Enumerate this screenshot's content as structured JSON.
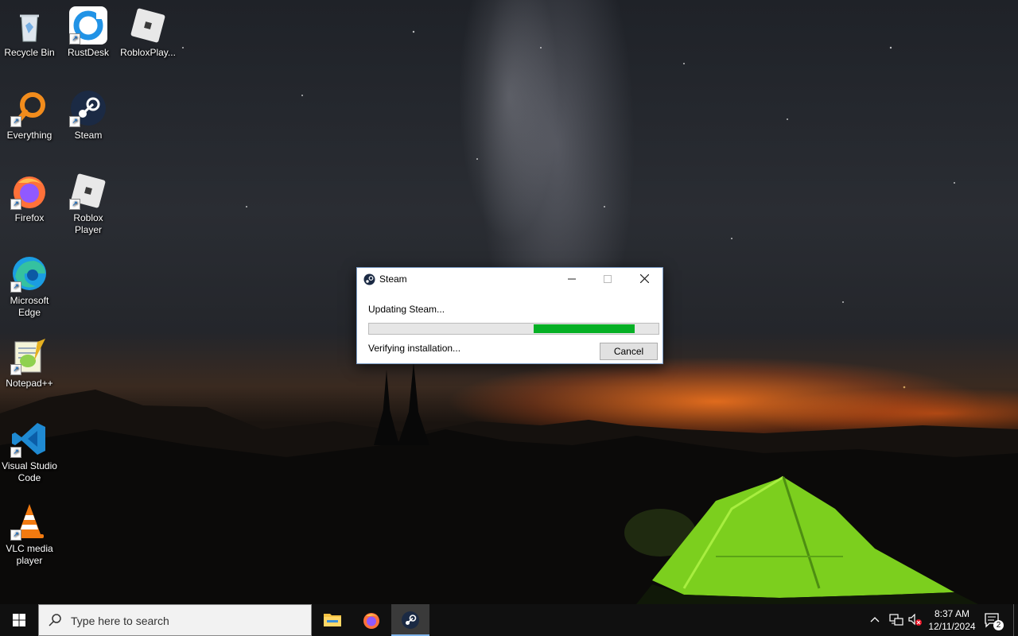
{
  "desktop_icons": [
    {
      "label": "Recycle Bin",
      "icon": "recycle-bin-icon"
    },
    {
      "label": "RustDesk",
      "icon": "rustdesk-icon"
    },
    {
      "label": "RobloxPlay...",
      "icon": "roblox-icon"
    },
    {
      "label": "Everything",
      "icon": "everything-search-icon"
    },
    {
      "label": "Steam",
      "icon": "steam-icon"
    },
    {
      "label": "Firefox",
      "icon": "firefox-icon"
    },
    {
      "label": "Roblox Player",
      "icon": "roblox-icon"
    },
    {
      "label": "Microsoft Edge",
      "icon": "edge-icon"
    },
    {
      "label": "Notepad++",
      "icon": "notepadpp-icon"
    },
    {
      "label": "Visual Studio Code",
      "icon": "vscode-icon"
    },
    {
      "label": "VLC media player",
      "icon": "vlc-icon"
    }
  ],
  "dialog": {
    "title": "Steam",
    "status": "Updating Steam...",
    "detail": "Verifying installation...",
    "cancel_label": "Cancel",
    "progress_fraction_start": 0.57,
    "progress_fraction_end": 0.92,
    "progress_color": "#06b025"
  },
  "taskbar": {
    "search_placeholder": "Type here to search",
    "apps": [
      "file-explorer-icon",
      "firefox-icon",
      "steam-icon"
    ],
    "active_app": "steam-icon",
    "time": "8:37 AM",
    "date": "12/11/2024",
    "notification_count": "2"
  }
}
